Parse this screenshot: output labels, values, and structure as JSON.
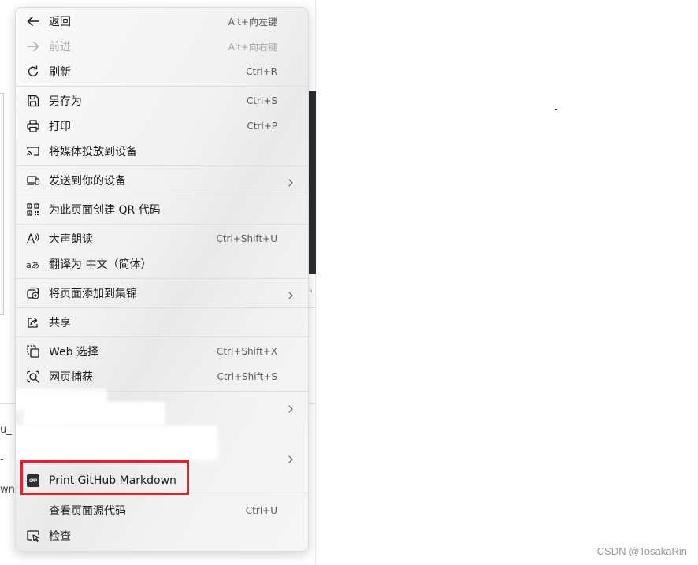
{
  "menu": {
    "items": [
      {
        "id": "back",
        "icon": "arrow-left-icon",
        "label": "返回",
        "shortcut": "Alt+向左键"
      },
      {
        "id": "forward",
        "icon": "arrow-right-icon",
        "label": "前进",
        "shortcut": "Alt+向右键",
        "disabled": true
      },
      {
        "id": "refresh",
        "icon": "refresh-icon",
        "label": "刷新",
        "shortcut": "Ctrl+R"
      },
      {
        "id": "save-as",
        "icon": "save-icon",
        "label": "另存为",
        "shortcut": "Ctrl+S"
      },
      {
        "id": "print",
        "icon": "printer-icon",
        "label": "打印",
        "shortcut": "Ctrl+P"
      },
      {
        "id": "cast",
        "icon": "cast-icon",
        "label": "将媒体投放到设备"
      },
      {
        "id": "send-to-device",
        "icon": "device-icon",
        "label": "发送到你的设备",
        "submenu": true
      },
      {
        "id": "qr-code",
        "icon": "qr-code-icon",
        "label": "为此页面创建 QR 代码"
      },
      {
        "id": "read-aloud",
        "icon": "read-aloud-icon",
        "label": "大声朗读",
        "shortcut": "Ctrl+Shift+U"
      },
      {
        "id": "translate",
        "icon": "translate-icon",
        "label": "翻译为 中文（简体）"
      },
      {
        "id": "add-to-collections",
        "icon": "collections-icon",
        "label": "将页面添加到集锦",
        "submenu": true
      },
      {
        "id": "share",
        "icon": "share-icon",
        "label": "共享"
      },
      {
        "id": "web-select",
        "icon": "web-select-icon",
        "label": "Web 选择",
        "shortcut": "Ctrl+Shift+X"
      },
      {
        "id": "web-capture",
        "icon": "web-capture-icon",
        "label": "网页捕获",
        "shortcut": "Ctrl+Shift+S"
      },
      {
        "id": "print-github-markdown",
        "icon": "gmp-extension-icon",
        "label": "Print GitHub Markdown",
        "badge": "GMP"
      },
      {
        "id": "view-source",
        "label": "查看页面源代码",
        "shortcut": "Ctrl+U"
      },
      {
        "id": "inspect",
        "icon": "inspect-icon",
        "label": "检查"
      }
    ]
  },
  "background": {
    "fragments": [
      "u_",
      "-",
      "wn p"
    ]
  },
  "watermark": "CSDN @TosakaRin",
  "colors": {
    "highlight": "#e8202a",
    "menu_bg": "#f3f3f3"
  }
}
